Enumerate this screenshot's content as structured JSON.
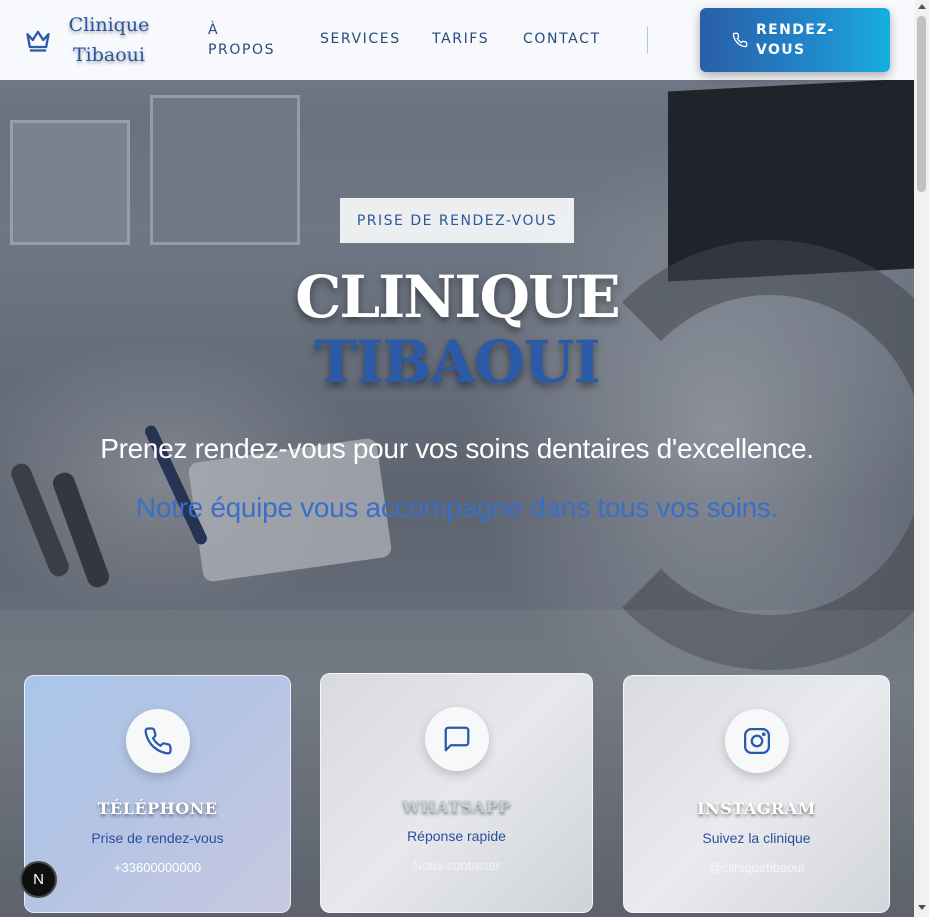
{
  "header": {
    "logo_line1": "Clinique",
    "logo_line2": "Tibaoui",
    "logo_icon": "crown-icon",
    "nav": {
      "apropos": "À PROPOS",
      "services": "SERVICES",
      "tarifs": "TARIFS",
      "contact": "CONTACT"
    },
    "cta_label": "RENDEZ-VOUS",
    "cta_icon": "phone-icon"
  },
  "hero": {
    "badge": "PRISE DE RENDEZ-VOUS",
    "title_line1": "CLINIQUE",
    "title_line2": "TIBAOUI",
    "subtitle": "Prenez rendez-vous pour vos soins dentaires d'excellence.",
    "subtitle_2": "Notre équipe vous accompagne dans tous vos soins."
  },
  "cards": [
    {
      "icon": "phone-icon",
      "title": "TÉLÉPHONE",
      "subtitle": "Prise de rendez-vous",
      "value": "+33600000000"
    },
    {
      "icon": "chat-bubble-icon",
      "title": "WHATSAPP",
      "subtitle": "Réponse rapide",
      "value": "Nous contacter"
    },
    {
      "icon": "instagram-icon",
      "title": "INSTAGRAM",
      "subtitle": "Suivez la clinique",
      "value": "@cliniquetibaoui"
    }
  ],
  "floating_button": "N",
  "colors": {
    "brand_blue": "#2a5aa8",
    "cta_gradient_start": "#2a5ea8",
    "cta_gradient_end": "#16b0e0",
    "header_bg": "#f7f9fc"
  }
}
